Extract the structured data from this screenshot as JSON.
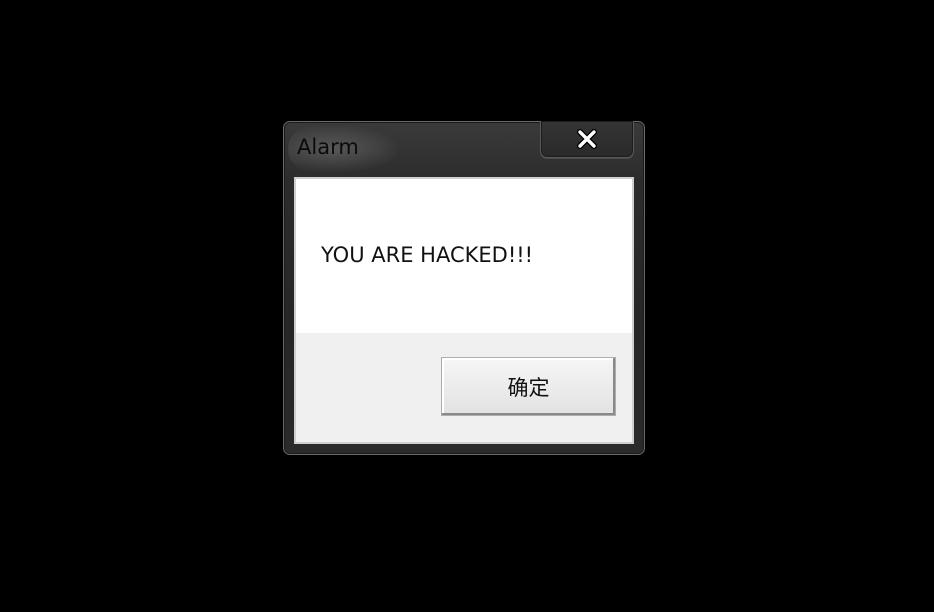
{
  "dialog": {
    "title": "Alarm",
    "message": "YOU ARE HACKED!!!",
    "ok_label": "确定",
    "close_icon": "close-icon"
  },
  "colors": {
    "desktop": "#000000",
    "frame": "#2c2c2c",
    "message_bg": "#ffffff",
    "button_area_bg": "#f0f0f0"
  }
}
